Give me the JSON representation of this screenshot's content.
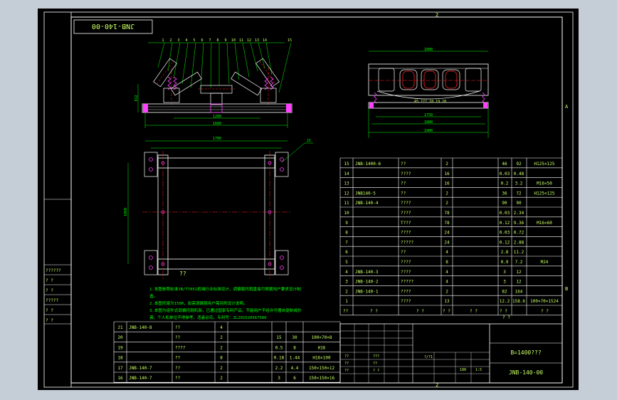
{
  "colors": {
    "window_bg": "#c5cdd6",
    "canvas_bg": "#000000",
    "frame": "#ffffff",
    "table_line": "#ffffff",
    "text": "#c8ff64",
    "green": "#00ff00",
    "red": "#ff2020",
    "magenta": "#ff40ff",
    "cyan": "#40e0ff",
    "yellow": "#ffff40"
  },
  "drawing": {
    "code_box": "JNB-140-00",
    "zone_top": "2",
    "zone_bottom": "2",
    "zone_right_a": "A",
    "zone_right_b": "B",
    "balloons": [
      "1",
      "2",
      "3",
      "4",
      "5",
      "6",
      "7",
      "8",
      "9",
      "10",
      "11",
      "12",
      "13",
      "14",
      "15"
    ],
    "dim_top_width": "1600",
    "dim_side_height": "812",
    "dim_base": "1200",
    "dim_frame_width": "1700",
    "dim_frame_height": "1870",
    "dim_plan_side": "1860",
    "dim_right_top": "1000",
    "dim_right_b1": "1750",
    "dim_right_b2": "1800",
    "dim_right_b3": "1900",
    "right_view_labels": "A5  ??? 18 19 20",
    "leader_21": "21",
    "plan_caption": "??",
    "notes": [
      "1.本图参照标准JB/T7051机械行业标准设计，调偏辊托辊直接可根据用户要求设计制",
      "造。",
      "2.本图托辊为1500，如需调偏辊用户需另附设计说明。",
      "3.本图为组件式调偏托辊机架，已通过国家专利产品，不能用户不经许可擅自复制或抄",
      "袭，个人和单位不得参考，违者必究。专利号：ZL201520567586"
    ]
  },
  "side_labels": [
    "??????",
    "? ?",
    "? ?",
    "?????",
    "? ?",
    "? ?"
  ],
  "bom_upper": [
    {
      "no": "15",
      "code": "JNB-1400-6",
      "name": "??",
      "qty": "2",
      "w1": "46",
      "w2": "92",
      "note": "H125×125"
    },
    {
      "no": "14",
      "code": "",
      "name": "????",
      "qty": "16",
      "w1": "0.03",
      "w2": "0.48",
      "note": ""
    },
    {
      "no": "13",
      "code": "",
      "name": "??",
      "qty": "16",
      "w1": "0.2",
      "w2": "3.2",
      "note": "M16×50"
    },
    {
      "no": "12",
      "code": "JNB140-5",
      "name": "??",
      "qty": "2",
      "w1": "36",
      "w2": "72",
      "note": "H125×125"
    },
    {
      "no": "11",
      "code": "JNB-140-4",
      "name": "????",
      "qty": "2",
      "w1": "90",
      "w2": "90",
      "note": ""
    },
    {
      "no": "10",
      "code": "",
      "name": "????",
      "qty": "78",
      "w1": "0.03",
      "w2": "2.34",
      "note": ""
    },
    {
      "no": "9",
      "code": "",
      "name": "T???",
      "qty": "78",
      "w1": "0.12",
      "w2": "9.36",
      "note": "M16×60"
    },
    {
      "no": "8",
      "code": "",
      "name": "????",
      "qty": "24",
      "w1": "0.03",
      "w2": "0.72",
      "note": ""
    },
    {
      "no": "7",
      "code": "",
      "name": "?????",
      "qty": "24",
      "w1": "0.12",
      "w2": "2.88",
      "note": ""
    },
    {
      "no": "6",
      "code": "",
      "name": "??",
      "qty": "4",
      "w1": "2.8",
      "w2": "11.2",
      "note": ""
    },
    {
      "no": "5",
      "code": "",
      "name": "????",
      "qty": "8",
      "w1": "0.9",
      "w2": "7.2",
      "note": "M24"
    },
    {
      "no": "4",
      "code": "JNB-140-3",
      "name": "????",
      "qty": "4",
      "w1": "3",
      "w2": "12",
      "note": ""
    },
    {
      "no": "3",
      "code": "JNB-140-2",
      "name": "?????",
      "qty": "4",
      "w1": "3",
      "w2": "12",
      "note": ""
    },
    {
      "no": "2",
      "code": "JNB-140-1",
      "name": "????",
      "qty": "2",
      "w1": "82",
      "w2": "164",
      "note": ""
    },
    {
      "no": "1",
      "code": "",
      "name": "????",
      "qty": "13",
      "w1": "12.2",
      "w2": "158.6",
      "note": "100×70×1524"
    }
  ],
  "bom_upper_header": {
    "no": "??",
    "code": "? ?",
    "name": "? ?",
    "qty": "? ?",
    "mat": "? ?",
    "w1": "? ?",
    "w2": "? ?",
    "note": "? ?",
    "sub": "? ?"
  },
  "bom_lower": [
    {
      "no": "21",
      "code": "JNB-140-8",
      "name": "??",
      "qty": "4",
      "w1": "",
      "w2": "",
      "note": ""
    },
    {
      "no": "20",
      "code": "",
      "name": "??",
      "qty": "2",
      "w1": "15",
      "w2": "30",
      "note": "100×70×8"
    },
    {
      "no": "19",
      "code": "",
      "name": "????",
      "qty": "2",
      "w1": "0.5",
      "w2": "8",
      "note": "H16"
    },
    {
      "no": "18",
      "code": "",
      "name": "??",
      "qty": "8",
      "w1": "0.18",
      "w2": "1.44",
      "note": "H16×100"
    },
    {
      "no": "17",
      "code": "JNB-140-7",
      "name": "??",
      "qty": "2",
      "w1": "2.2",
      "w2": "4.4",
      "note": "150×150×12"
    },
    {
      "no": "16",
      "code": "JNB-140-7",
      "name": "??",
      "qty": "2",
      "w1": "3",
      "w2": "6",
      "note": "150×150×16"
    }
  ],
  "title_block": {
    "title": "B=1400???",
    "drawing_no": "JNB-140-00",
    "scale_label": "?/?1",
    "weight": "100",
    "scale": "1:5",
    "row_labels": [
      "??",
      "???",
      "??",
      "??",
      "??",
      "? ?"
    ]
  }
}
